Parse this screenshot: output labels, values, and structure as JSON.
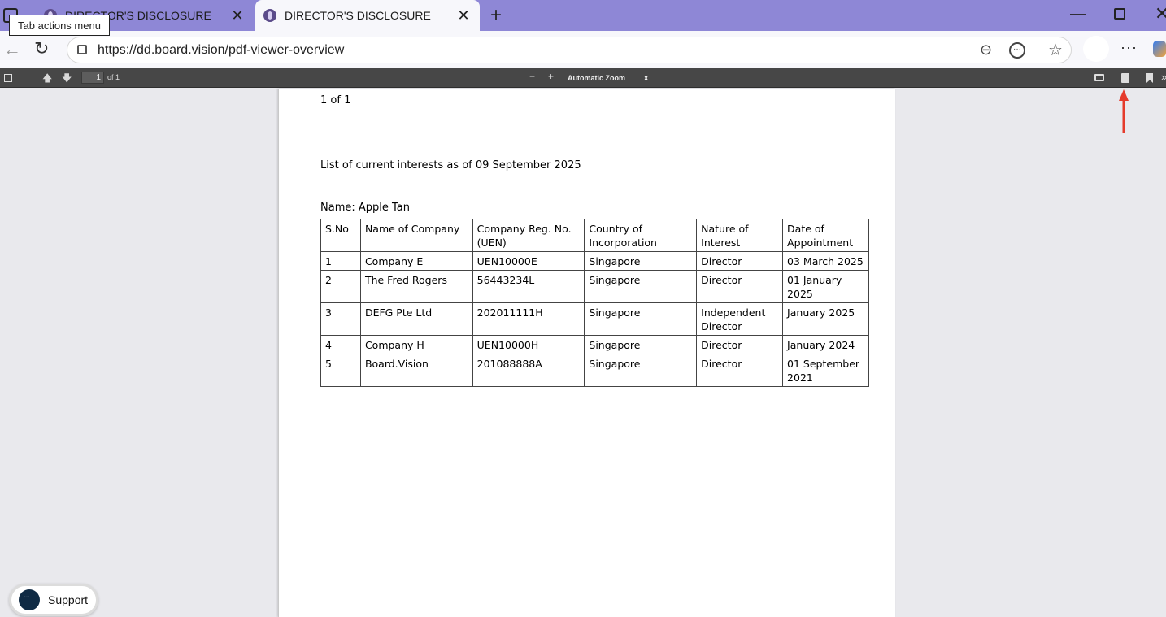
{
  "tooltip": "Tab actions menu",
  "tabs": [
    {
      "title": "DIRECTOR'S DISCLOSURE",
      "close": "✕"
    },
    {
      "title": "DIRECTOR'S DISCLOSURE",
      "close": "✕"
    }
  ],
  "browser": {
    "new_tab": "+",
    "url": "https://dd.board.vision/pdf-viewer-overview",
    "menu": "···",
    "minimize": "—",
    "close": "✕"
  },
  "pdf_toolbar": {
    "page_input": "1",
    "page_count": "of 1",
    "zoom_out": "−",
    "zoom_in": "+",
    "zoom_level": "Automatic Zoom",
    "more": "»"
  },
  "document": {
    "page_label": "1 of 1",
    "heading": "List of current interests as of 09 September 2025",
    "name": "Name: Apple Tan",
    "columns": [
      "S.No",
      "Name of Company",
      "Company Reg. No. (UEN)",
      "Country of Incorporation",
      "Nature of Interest",
      "Date of Appointment"
    ],
    "rows": [
      [
        "1",
        "Company E",
        "UEN10000E",
        "Singapore",
        "Director",
        "03 March 2025"
      ],
      [
        "2",
        "The Fred Rogers",
        "56443234L",
        "Singapore",
        "Director",
        "01 January 2025"
      ],
      [
        "3",
        "DEFG Pte Ltd",
        "202011111H",
        "Singapore",
        "Independent Director",
        "January 2025"
      ],
      [
        "4",
        "Company H",
        "UEN10000H",
        "Singapore",
        "Director",
        "January 2024"
      ],
      [
        "5",
        "Board.Vision",
        "201088888A",
        "Singapore",
        "Director",
        "01 September 2021"
      ]
    ]
  },
  "support": {
    "label": "Support"
  },
  "annotation_color": "#e53b2c"
}
